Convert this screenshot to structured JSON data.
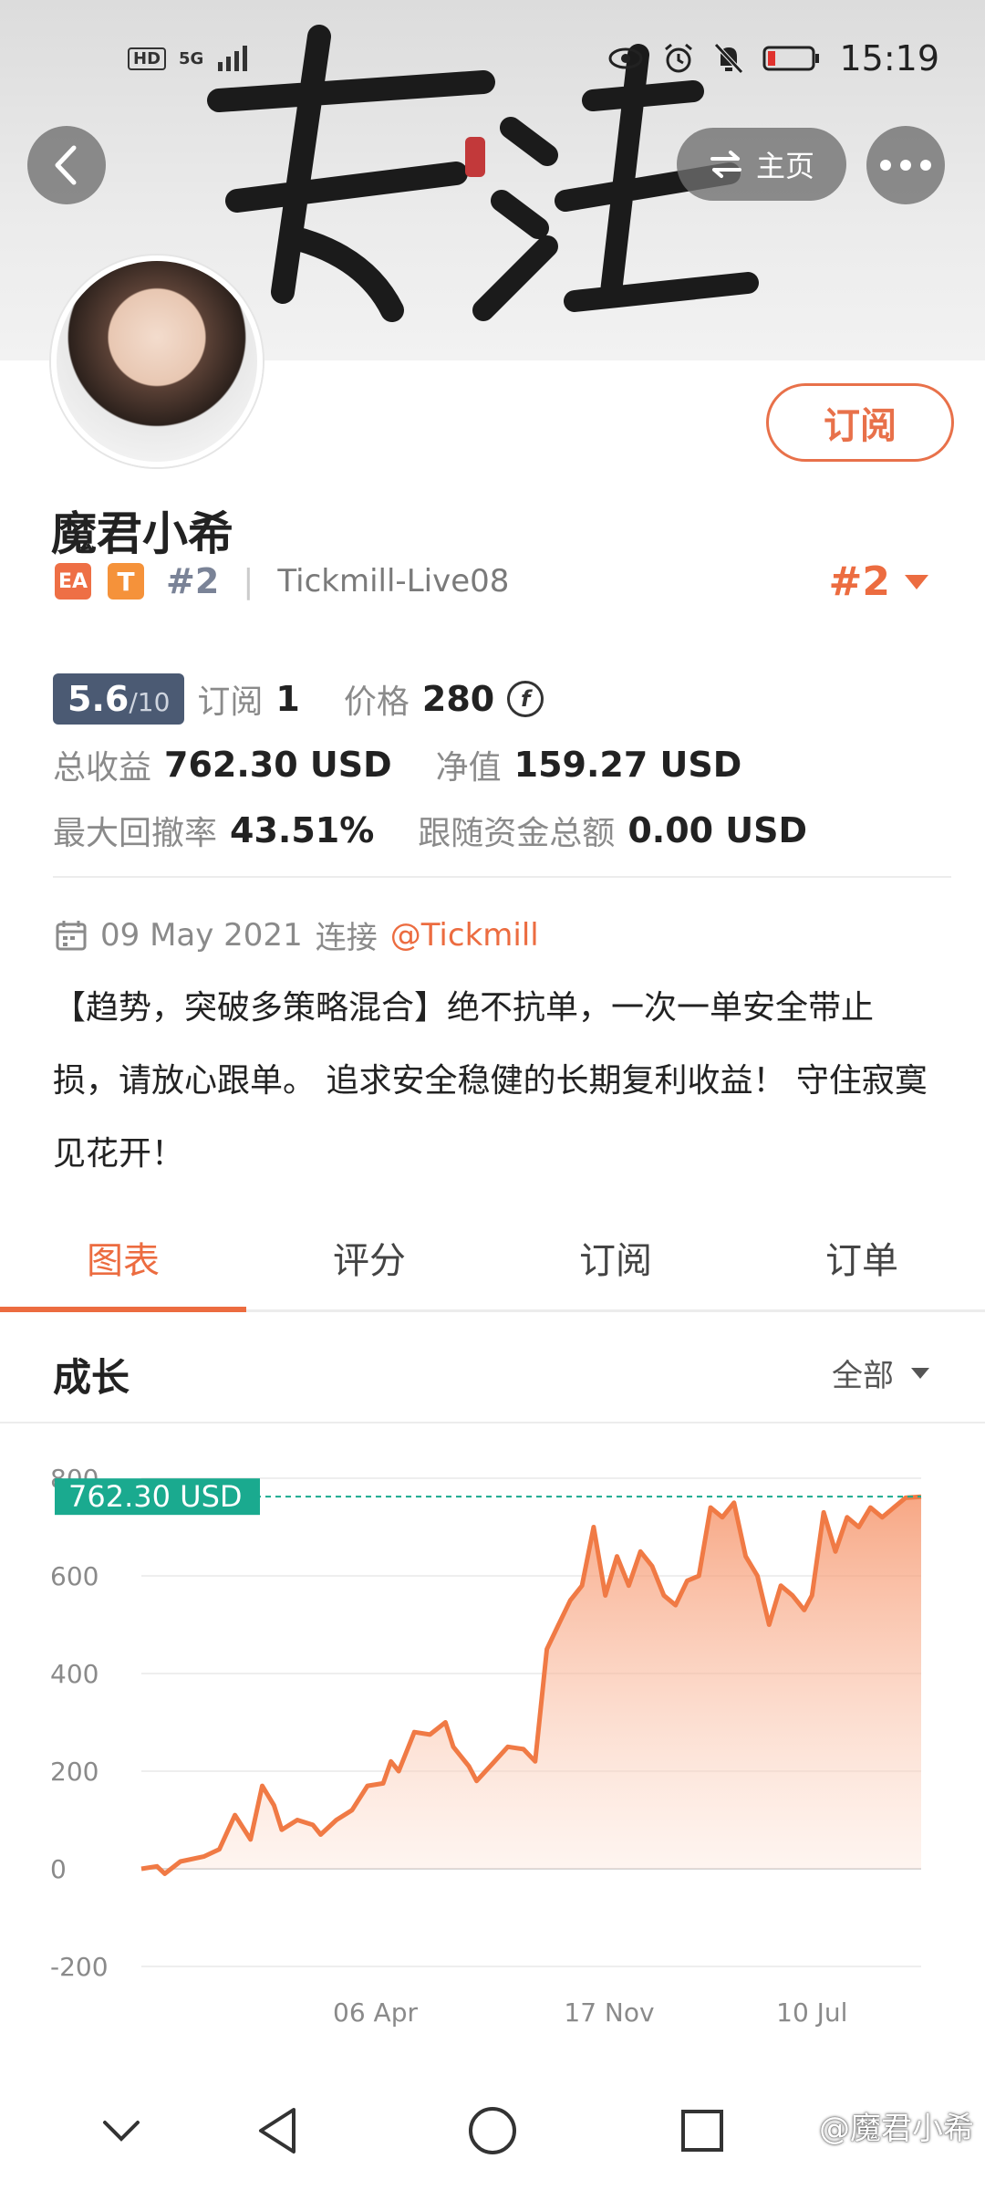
{
  "status_bar": {
    "hd": "HD",
    "network": "5G",
    "time": "15:19"
  },
  "header": {
    "home_label": "主页"
  },
  "profile": {
    "name": "魔君小希",
    "subscribe_label": "订阅",
    "tag_ea": "EA",
    "tag_t": "T",
    "rank_small": "#2",
    "account": "Tickmill-Live08",
    "rank": "#2"
  },
  "stats": {
    "score": "5.6",
    "score_out_of": "/10",
    "subscriptions_label": "订阅",
    "subscriptions_value": "1",
    "price_label": "价格",
    "price_value": "280",
    "total_profit_label": "总收益",
    "total_profit_value": "762.30 USD",
    "net_value_label": "净值",
    "net_value_value": "159.27 USD",
    "max_drawdown_label": "最大回撤率",
    "max_drawdown_value": "43.51%",
    "follow_funds_label": "跟随资金总额",
    "follow_funds_value": "0.00 USD"
  },
  "info": {
    "date": "09 May 2021",
    "connect_label": "连接",
    "broker_mention": "@Tickmill",
    "description": "【趋势，突破多策略混合】绝不抗单，一次一单安全带止损，请放心跟单。 追求安全稳健的长期复利收益！ 守住寂寞见花开！"
  },
  "tabs": [
    "图表",
    "评分",
    "订阅",
    "订单"
  ],
  "growth": {
    "title": "成长",
    "range": "全部"
  },
  "chart_data": {
    "type": "area",
    "current_label": "762.30 USD",
    "current_value": 762.3,
    "ylim": [
      -200,
      800
    ],
    "yticks": [
      800,
      600,
      400,
      200,
      0,
      -200
    ],
    "ytick_labels": [
      "800",
      "600",
      "400",
      "200",
      "0",
      "-200"
    ],
    "xtick_labels": [
      "06 Apr",
      "17 Nov",
      "10 Jul"
    ],
    "xtick_positions": [
      0.3,
      0.6,
      0.86
    ],
    "series": [
      {
        "color": "#f07a45",
        "points": [
          [
            0.0,
            0
          ],
          [
            0.02,
            5
          ],
          [
            0.03,
            -10
          ],
          [
            0.05,
            15
          ],
          [
            0.08,
            25
          ],
          [
            0.1,
            40
          ],
          [
            0.12,
            110
          ],
          [
            0.14,
            60
          ],
          [
            0.155,
            170
          ],
          [
            0.17,
            130
          ],
          [
            0.18,
            80
          ],
          [
            0.2,
            100
          ],
          [
            0.22,
            90
          ],
          [
            0.23,
            70
          ],
          [
            0.25,
            100
          ],
          [
            0.27,
            120
          ],
          [
            0.29,
            170
          ],
          [
            0.31,
            175
          ],
          [
            0.32,
            220
          ],
          [
            0.33,
            200
          ],
          [
            0.35,
            280
          ],
          [
            0.37,
            275
          ],
          [
            0.39,
            300
          ],
          [
            0.4,
            250
          ],
          [
            0.42,
            210
          ],
          [
            0.43,
            180
          ],
          [
            0.45,
            215
          ],
          [
            0.47,
            250
          ],
          [
            0.49,
            245
          ],
          [
            0.505,
            220
          ],
          [
            0.52,
            450
          ],
          [
            0.535,
            500
          ],
          [
            0.55,
            550
          ],
          [
            0.565,
            580
          ],
          [
            0.58,
            700
          ],
          [
            0.595,
            560
          ],
          [
            0.61,
            640
          ],
          [
            0.625,
            580
          ],
          [
            0.64,
            650
          ],
          [
            0.655,
            620
          ],
          [
            0.67,
            560
          ],
          [
            0.685,
            540
          ],
          [
            0.7,
            590
          ],
          [
            0.715,
            600
          ],
          [
            0.73,
            740
          ],
          [
            0.745,
            720
          ],
          [
            0.76,
            750
          ],
          [
            0.775,
            640
          ],
          [
            0.79,
            600
          ],
          [
            0.805,
            500
          ],
          [
            0.82,
            580
          ],
          [
            0.835,
            560
          ],
          [
            0.85,
            530
          ],
          [
            0.86,
            560
          ],
          [
            0.875,
            730
          ],
          [
            0.89,
            650
          ],
          [
            0.905,
            720
          ],
          [
            0.92,
            700
          ],
          [
            0.935,
            740
          ],
          [
            0.95,
            720
          ],
          [
            0.965,
            740
          ],
          [
            0.98,
            760
          ],
          [
            1.0,
            762
          ]
        ]
      }
    ]
  },
  "watermark": "@魔君小希"
}
